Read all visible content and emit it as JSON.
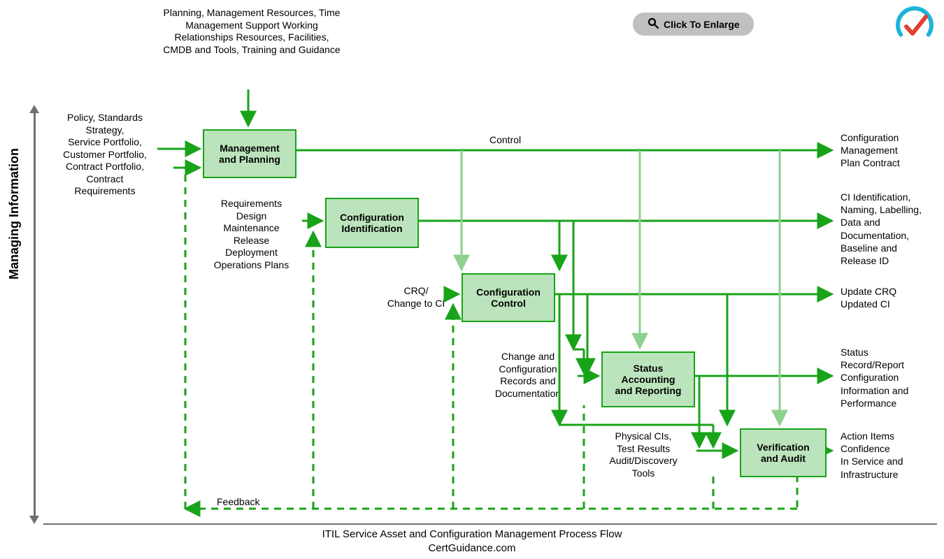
{
  "enlarge": "Click To Enlarge",
  "sidelabel": "Managing Information",
  "topInput": "Planning, Management Resources, Time Management Support Working Relationships Resources, Facilities, CMDB and Tools, Training and Guidance",
  "leftInput": "Policy, Standards Strategy,\nService Portfolio,\nCustomer Portfolio,\nContract Portfolio,\nContract\nRequirements",
  "controlLabel": "Control",
  "feedbackLabel": "Feedback",
  "boxes": {
    "b1": "Management\nand Planning",
    "b2": "Configuration\nIdentification",
    "b3": "Configuration\nControl",
    "b4": "Status\nAccounting\nand Reporting",
    "b5": "Verification\nand Audit"
  },
  "inputs": {
    "i2": "Requirements\nDesign\nMaintenance\nRelease\nDeployment\nOperations Plans",
    "i3": "CRQ/\nChange to CI",
    "i4": "Change and\nConfiguration\nRecords and\nDocumentation",
    "i5": "Physical CIs,\nTest Results\nAudit/Discovery\nTools"
  },
  "outputs": {
    "o1": "Configuration\nManagement\nPlan Contract",
    "o2": "CI Identification,\nNaming, Labelling,\nData and\nDocumentation,\nBaseline and\nRelease ID",
    "o3": "Update CRQ\nUpdated CI",
    "o4": "Status\nRecord/Report\nConfiguration\nInformation and\nPerformance",
    "o5": "Action Items\nConfidence\nIn Service and\nInfrastructure"
  },
  "caption": "ITIL Service Asset and Configuration Management Process Flow",
  "site": "CertGuidance.com"
}
